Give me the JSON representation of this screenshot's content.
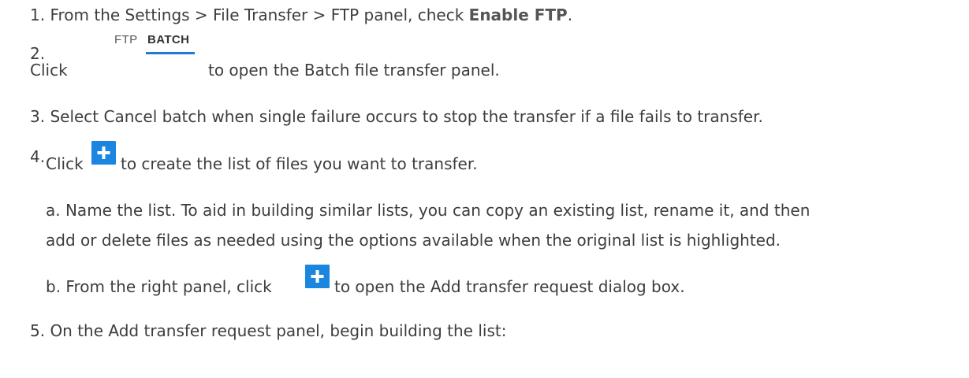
{
  "steps": {
    "s1": {
      "prefix": "1. From the Settings > File Transfer > FTP panel, check ",
      "bold": "Enable FTP",
      "suffix": "."
    },
    "s2": {
      "number": "2.",
      "click": "Click",
      "tab_ftp": "FTP",
      "tab_batch": "BATCH",
      "suffix": "to open the Batch file transfer panel."
    },
    "s3": {
      "text": "3. Select Cancel batch when single failure occurs to stop the transfer if a file fails to transfer."
    },
    "s4": {
      "number": "4.",
      "click": "Click",
      "suffix": "to create the list of files you want to transfer.",
      "icon": "plus-icon"
    },
    "s4a": {
      "line1": "a. Name the list. To aid in building similar lists, you can copy an existing list, rename it, and then",
      "line2": "add or delete files as needed using the options available when the original list is highlighted."
    },
    "s4b": {
      "prefix": "b. From the right panel, click",
      "suffix": "to open the Add transfer request dialog box.",
      "icon": "plus-icon"
    },
    "s5": {
      "text": "5. On the Add transfer request panel, begin building the list:"
    }
  },
  "colors": {
    "text": "#3d3d3d",
    "accent": "#1a86e0",
    "tab_underline": "#1e7bd6"
  }
}
